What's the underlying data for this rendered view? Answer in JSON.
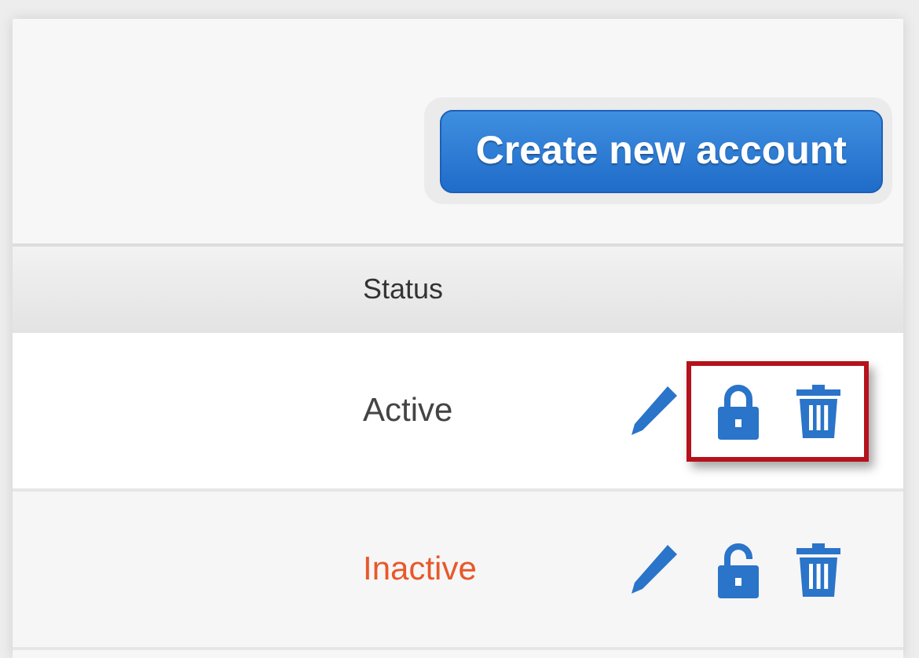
{
  "create_button": {
    "label": "Create new account"
  },
  "table": {
    "columns": [
      {
        "label": "Status"
      }
    ],
    "rows": [
      {
        "status": "Active",
        "color": "#444444",
        "locked": true,
        "highlighted": true
      },
      {
        "status": "Inactive",
        "color": "#e8582a",
        "locked": false,
        "highlighted": false
      }
    ]
  }
}
